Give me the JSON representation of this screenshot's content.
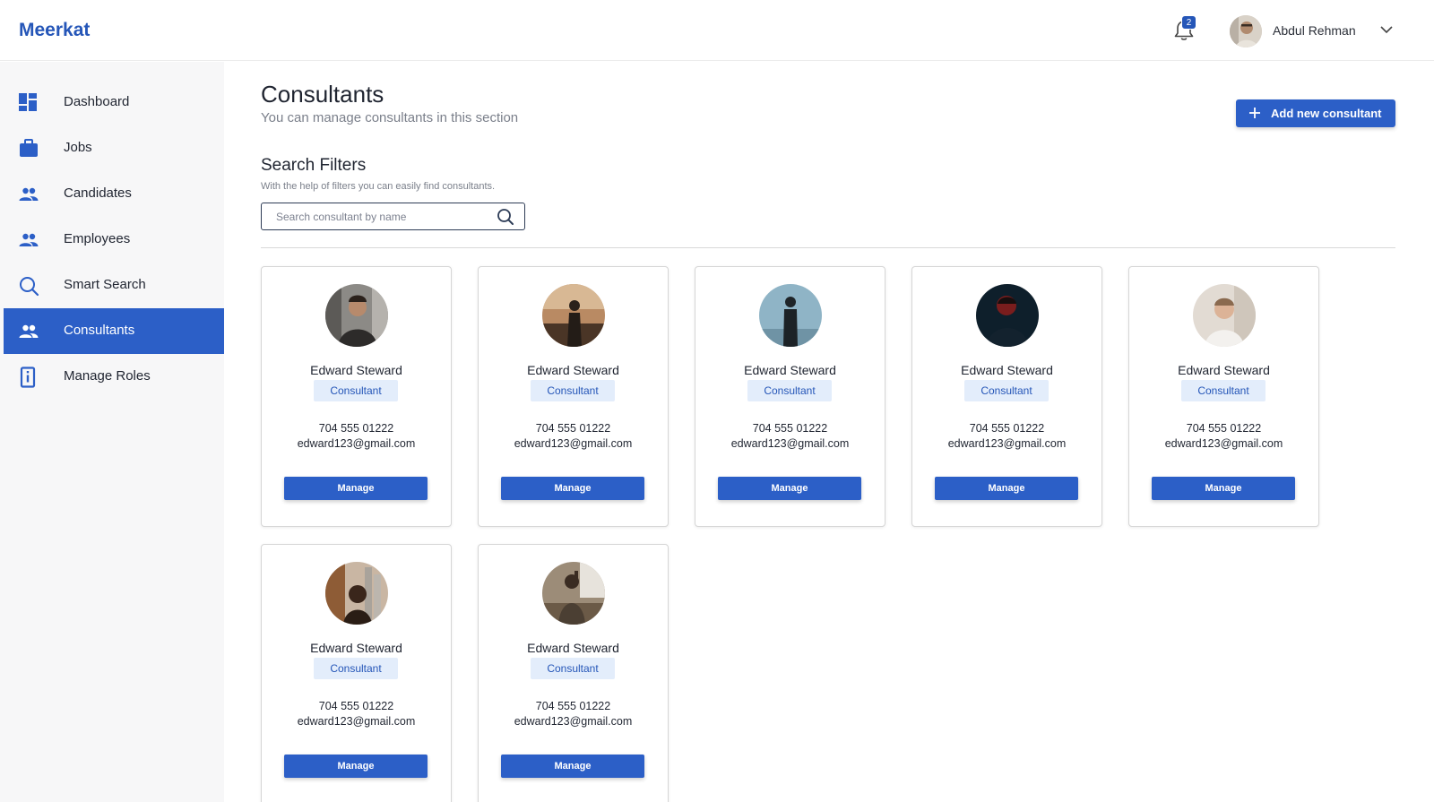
{
  "app": {
    "brand": "Meerkat"
  },
  "header": {
    "notification_count": "2",
    "user_name": "Abdul Rehman"
  },
  "sidebar": {
    "items": [
      {
        "label": "Dashboard",
        "icon": "dashboard-icon"
      },
      {
        "label": "Jobs",
        "icon": "briefcase-icon"
      },
      {
        "label": "Candidates",
        "icon": "people-icon"
      },
      {
        "label": "Employees",
        "icon": "people-icon"
      },
      {
        "label": "Smart Search",
        "icon": "search-icon"
      },
      {
        "label": "Consultants",
        "icon": "people-icon",
        "active": true
      },
      {
        "label": "Manage Roles",
        "icon": "id-badge-icon"
      }
    ]
  },
  "main": {
    "title": "Consultants",
    "subtitle": "You can manage consultants in this section",
    "add_button_label": "Add new consultant",
    "filters": {
      "title": "Search Filters",
      "subtitle": "With the help of filters you can easily find consultants.",
      "search_placeholder": "Search consultant by name"
    },
    "consultants": [
      {
        "name": "Edward Steward",
        "role": "Consultant",
        "phone": "704 555 01222",
        "email": "edward123@gmail.com",
        "manage_label": "Manage"
      },
      {
        "name": "Edward Steward",
        "role": "Consultant",
        "phone": "704 555 01222",
        "email": "edward123@gmail.com",
        "manage_label": "Manage"
      },
      {
        "name": "Edward Steward",
        "role": "Consultant",
        "phone": "704 555 01222",
        "email": "edward123@gmail.com",
        "manage_label": "Manage"
      },
      {
        "name": "Edward Steward",
        "role": "Consultant",
        "phone": "704 555 01222",
        "email": "edward123@gmail.com",
        "manage_label": "Manage"
      },
      {
        "name": "Edward Steward",
        "role": "Consultant",
        "phone": "704 555 01222",
        "email": "edward123@gmail.com",
        "manage_label": "Manage"
      },
      {
        "name": "Edward Steward",
        "role": "Consultant",
        "phone": "704 555 01222",
        "email": "edward123@gmail.com",
        "manage_label": "Manage"
      },
      {
        "name": "Edward Steward",
        "role": "Consultant",
        "phone": "704 555 01222",
        "email": "edward123@gmail.com",
        "manage_label": "Manage"
      }
    ]
  },
  "colors": {
    "accent": "#2c5fc7",
    "brand": "#2556b8",
    "badge_bg": "#e3edfb"
  }
}
